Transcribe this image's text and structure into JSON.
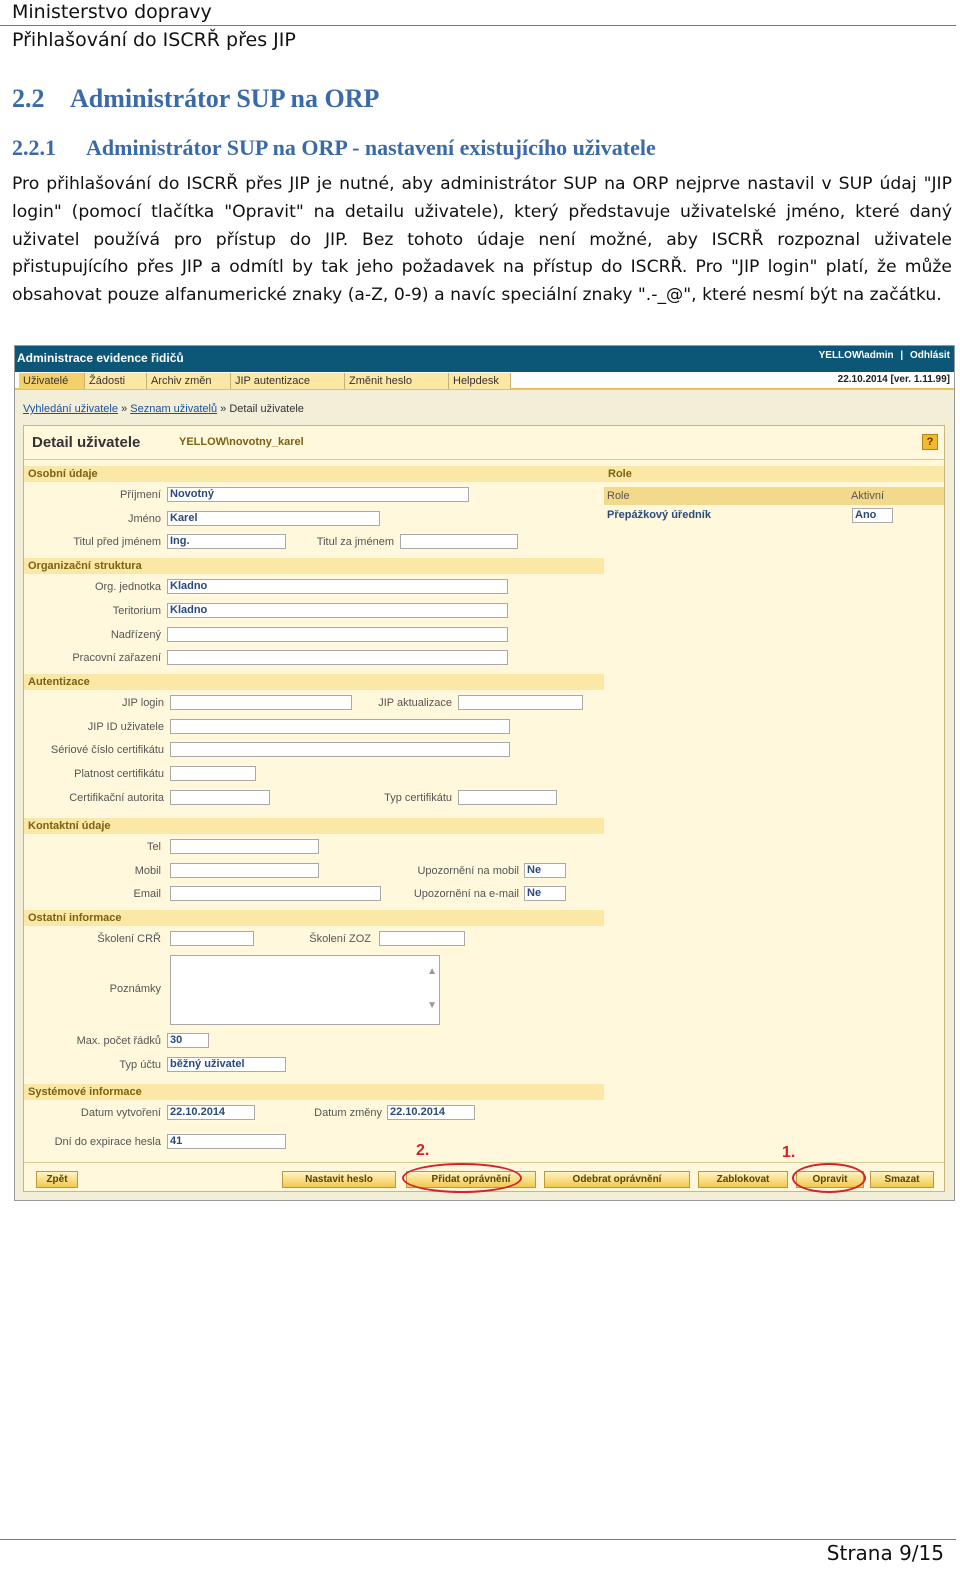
{
  "header": {
    "line1": "Ministerstvo dopravy",
    "line2": "Přihlašování do ISCRŘ přes JIP"
  },
  "section": {
    "num": "2.2",
    "title": "Administrátor SUP na ORP"
  },
  "subsection": {
    "num": "2.2.1",
    "title": "Administrátor SUP na ORP - nastavení existujícího uživatele"
  },
  "paragraph": "Pro přihlašování do ISCRŘ přes JIP je nutné, aby administrátor SUP na ORP nejprve nastavil v SUP údaj \"JIP login\" (pomocí tlačítka \"Opravit\" na detailu uživatele), který představuje uživatelské jméno, které daný uživatel používá pro přístup do JIP. Bez tohoto údaje není možné, aby ISCRŘ rozpoznal uživatele přistupujícího přes JIP a odmítl by tak jeho požadavek na přístup do ISCRŘ. Pro \"JIP login\" platí, že může obsahovat pouze alfanumerické znaky (a-Z, 0-9) a navíc speciální znaky \".-_@\", které nesmí být na začátku.",
  "app": {
    "title": "Administrace evidence řidičů",
    "user": "YELLOW\\admin",
    "separator": "|",
    "logout": "Odhlásit",
    "date": "22.10.2014",
    "version": "[ver. 1.11.99]",
    "menu": [
      "Uživatelé",
      "Žádosti",
      "Archiv změn",
      "JIP autentizace",
      "Změnit heslo",
      "Helpdesk"
    ],
    "breadcrumb": {
      "b1": "Vyhledání uživatele",
      "sep": "»",
      "b2": "Seznam uživatelů",
      "b3": "Detail uživatele"
    },
    "detail": {
      "title": "Detail uživatele",
      "login": "YELLOW\\novotny_karel",
      "help": "?"
    },
    "sections": {
      "personal": "Osobní údaje",
      "org": "Organizační struktura",
      "auth": "Autentizace",
      "contact": "Kontaktní údaje",
      "other": "Ostatní informace",
      "system": "Systémové informace"
    },
    "labels": {
      "surname": "Příjmení",
      "name": "Jméno",
      "title_before": "Titul před jménem",
      "title_after": "Titul za jménem",
      "org_unit": "Org. jednotka",
      "territory": "Teritorium",
      "superior": "Nadřízený",
      "position": "Pracovní zařazení",
      "jip_login": "JIP login",
      "jip_update": "JIP aktualizace",
      "jip_id": "JIP ID uživatele",
      "cert_serial": "Sériové číslo certifikátu",
      "cert_validity": "Platnost certifikátu",
      "cert_authority": "Certifikační autorita",
      "cert_type": "Typ certifikátu",
      "phone": "Tel",
      "mobile": "Mobil",
      "email": "Email",
      "notify_mobile": "Upozornění na mobil",
      "notify_email": "Upozornění na e-mail",
      "training_crr": "Školení CRŘ",
      "training_zoz": "Školení ZOZ",
      "notes": "Poznámky",
      "max_rows": "Max. počet řádků",
      "account_type": "Typ účtu",
      "created": "Datum vytvoření",
      "changed": "Datum změny",
      "days_expiry": "Dní do expirace hesla"
    },
    "values": {
      "surname": "Novotný",
      "name": "Karel",
      "title_before": "Ing.",
      "org_unit": "Kladno",
      "territory": "Kladno",
      "notify_mobile": "Ne",
      "notify_email": "Ne",
      "max_rows": "30",
      "account_type": "běžný uživatel",
      "created": "22.10.2014",
      "changed": "22.10.2014",
      "days_expiry": "41"
    },
    "role": {
      "section": "Role",
      "col_role": "Role",
      "col_active": "Aktivní",
      "row_role": "Přepážkový úředník",
      "row_active": "Ano"
    },
    "buttons": {
      "back": "Zpět",
      "set_password": "Nastavit heslo",
      "add_permission": "Přidat oprávnění",
      "remove_permission": "Odebrat oprávnění",
      "block": "Zablokovat",
      "edit": "Opravit",
      "delete": "Smazat"
    },
    "marks": {
      "one": "1.",
      "two": "2."
    },
    "colors": {
      "titlebar": "#0c5778",
      "annotation": "#d8202a",
      "heading": "#3a6aa8"
    }
  },
  "footer": {
    "page": "Strana 9/15"
  }
}
